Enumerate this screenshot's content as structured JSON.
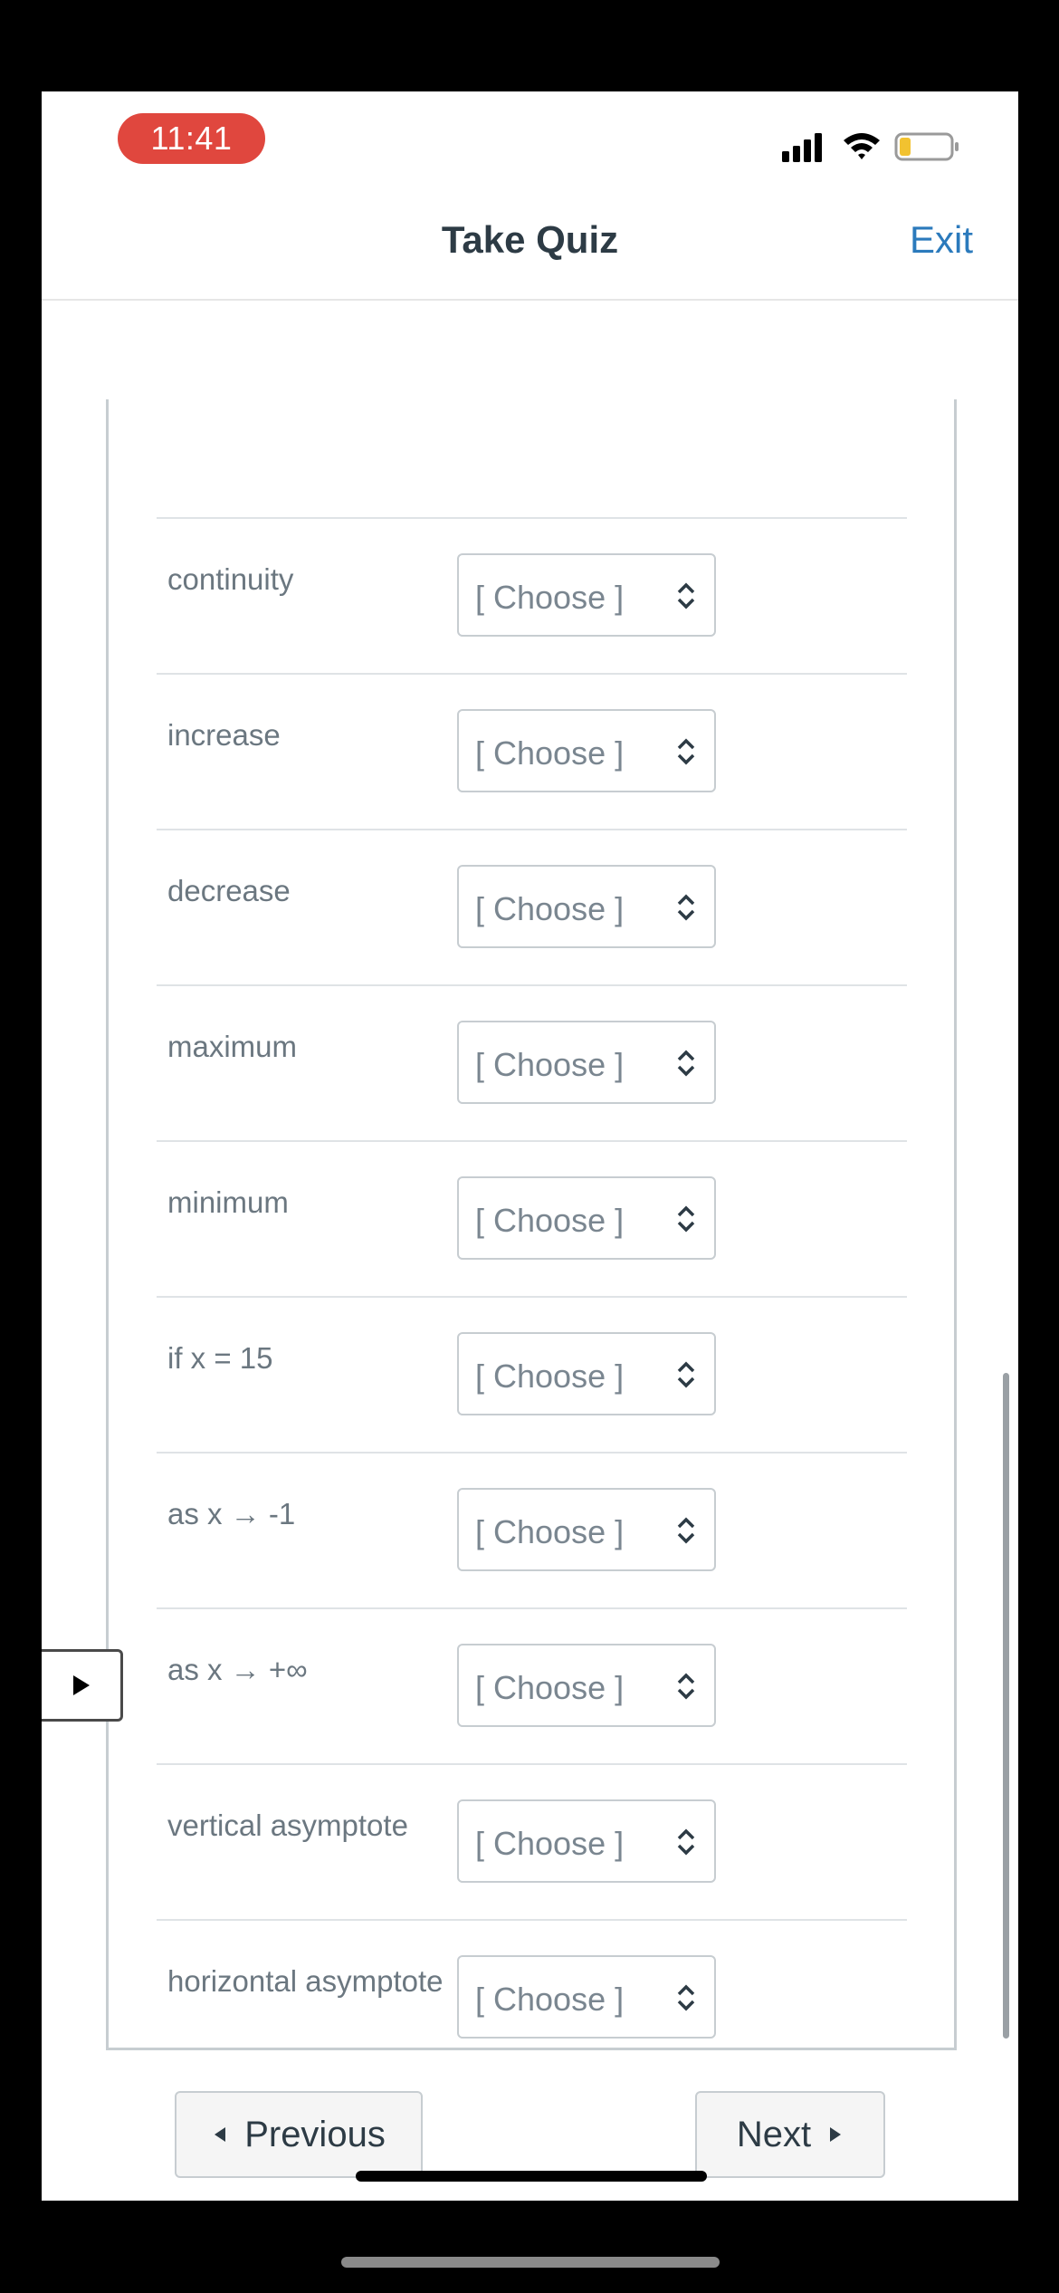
{
  "status_bar": {
    "time": "11:41",
    "signal_icon": "cellular-signal-icon",
    "wifi_icon": "wifi-icon",
    "battery_icon": "battery-low-icon",
    "battery_level": 0.2
  },
  "header": {
    "title": "Take Quiz",
    "exit_label": "Exit"
  },
  "quiz": {
    "rows": [
      {
        "label": "continuity",
        "selected": "[ Choose ]"
      },
      {
        "label": "increase",
        "selected": "[ Choose ]"
      },
      {
        "label": "decrease",
        "selected": "[ Choose ]"
      },
      {
        "label": "maximum",
        "selected": "[ Choose ]"
      },
      {
        "label": "minimum",
        "selected": "[ Choose ]"
      },
      {
        "label": "if x = 15",
        "selected": "[ Choose ]"
      },
      {
        "label": "as x → -1",
        "selected": "[ Choose ]"
      },
      {
        "label": "as x → +∞",
        "selected": "[ Choose ]"
      },
      {
        "label": "vertical asymptote",
        "selected": "[ Choose ]"
      },
      {
        "label": "horizontal asymptote",
        "selected": "[ Choose ]"
      }
    ]
  },
  "nav": {
    "previous_label": "Previous",
    "next_label": "Next"
  },
  "colors": {
    "time_pill": "#e0473e",
    "exit_link": "#2b7abc",
    "title": "#2d3b45",
    "battery_fill": "#f2c230"
  }
}
